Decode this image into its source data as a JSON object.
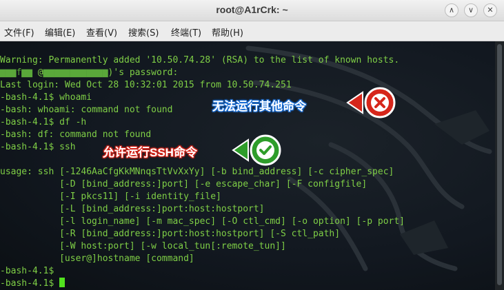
{
  "window": {
    "title": "root@A1rCrk: ~"
  },
  "window_controls": [
    "∧",
    "∨",
    "✕"
  ],
  "menu": [
    "文件(F)",
    "编辑(E)",
    "查看(V)",
    "搜索(S)",
    "终端(T)",
    "帮助(H)"
  ],
  "terminal": {
    "lines": [
      "Warning: Permanently added '10.50.74.28' (RSA) to the list of known hosts.",
      "",
      "Last login: Wed Oct 28 10:32:01 2015 from 10.50.74.251",
      "-bash-4.1$ whoami",
      "-bash: whoami: command not found",
      "-bash-4.1$ df -h",
      "-bash: df: command not found",
      "-bash-4.1$ ssh",
      "",
      "usage: ssh [-1246AaCfgKkMNnqsTtVvXxYy] [-b bind_address] [-c cipher_spec]",
      "           [-D [bind_address:]port] [-e escape_char] [-F configfile]",
      "           [-I pkcs11] [-i identity_file]",
      "           [-L [bind_address:]port:host:hostport]",
      "           [-l login_name] [-m mac_spec] [-O ctl_cmd] [-o option] [-p port]",
      "           [-R [bind_address:]port:host:hostport] [-S ctl_path]",
      "           [-W host:port] [-w local_tun[:remote_tun]]",
      "           [user@]hostname [command]",
      "-bash-4.1$",
      "-bash-4.1$ "
    ],
    "password_prompt": {
      "at_char": "@",
      "suffix": ")'s password:"
    }
  },
  "annotations": {
    "blocked": {
      "text": "无法运行其他命令",
      "icon": "x-circle-icon",
      "color": "#d6261b"
    },
    "allowed": {
      "text": "允许运行SSH命令",
      "icon": "check-circle-icon",
      "color": "#2e9d2a"
    }
  },
  "colors": {
    "terminal_text": "#7fcf46",
    "cursor": "#52e21f",
    "note_blue": "#1b6fd6",
    "note_red": "#d6261b"
  }
}
